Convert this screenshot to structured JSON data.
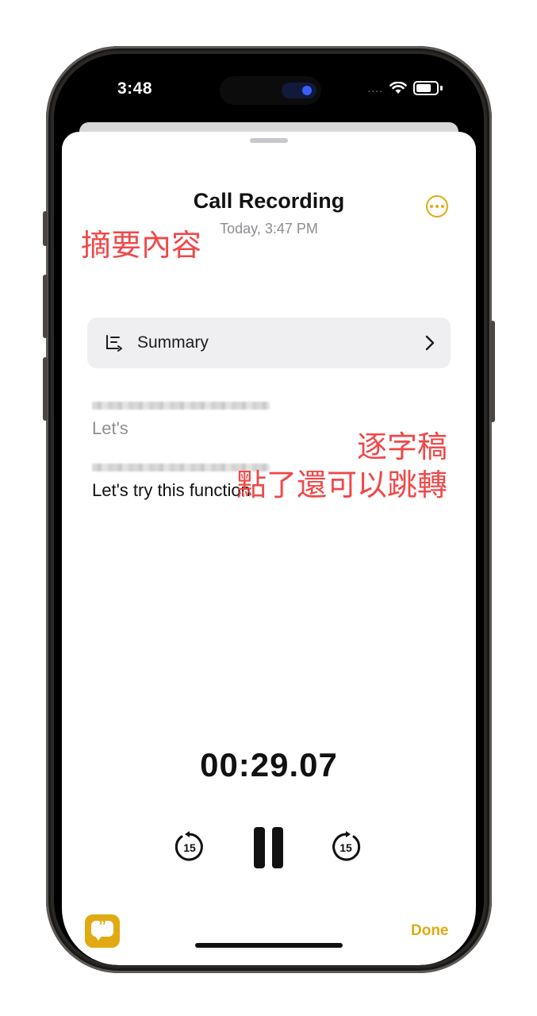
{
  "status_bar": {
    "time": "3:48",
    "signal": "....",
    "icons": [
      "wifi-icon",
      "battery-icon"
    ]
  },
  "recording": {
    "title": "Call Recording",
    "subtitle": "Today, 3:47 PM",
    "more_icon": "more-icon"
  },
  "summary": {
    "label": "Summary",
    "icon": "summary-icon",
    "chevron": "chevron-right-icon"
  },
  "transcript": {
    "lines": [
      {
        "text": "Let's",
        "state": "past"
      },
      {
        "text": "Let's try this function",
        "state": "current"
      }
    ]
  },
  "annotations": {
    "summary_note": "摘要內容",
    "transcript_note_line1": "逐字稿",
    "transcript_note_line2": "點了還可以跳轉"
  },
  "player": {
    "elapsed": "00:29.07",
    "skip_seconds": "15",
    "skip_back_icon": "skip-back-15-icon",
    "pause_icon": "pause-icon",
    "skip_forward_icon": "skip-forward-15-icon"
  },
  "footer": {
    "transcript_icon": "transcript-quote-icon",
    "done_label": "Done"
  },
  "colors": {
    "accent": "#e2aa12",
    "annotation": "#f04848",
    "summary_bg": "#efeff1",
    "secondary_text": "#8e8e93"
  }
}
